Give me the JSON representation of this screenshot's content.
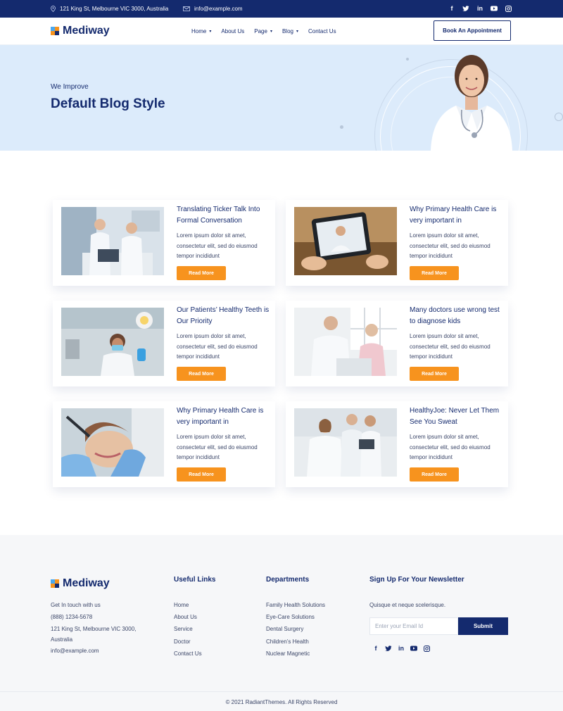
{
  "topbar": {
    "address": "121 King St, Melbourne VIC 3000, Australia",
    "email": "info@example.com",
    "social_icons": [
      "facebook-icon",
      "twitter-icon",
      "linkedin-icon",
      "youtube-icon",
      "instagram-icon"
    ]
  },
  "brand": {
    "name": "Mediway",
    "colors": {
      "navy": "#142a6e",
      "orange": "#f7931e",
      "hero_bg": "#dcebfb"
    }
  },
  "nav": {
    "items": [
      {
        "label": "Home",
        "dropdown": true
      },
      {
        "label": "About Us",
        "dropdown": false
      },
      {
        "label": "Page",
        "dropdown": true
      },
      {
        "label": "Blog",
        "dropdown": true
      },
      {
        "label": "Contact Us",
        "dropdown": false
      }
    ],
    "cta_label": "Book An Appointment"
  },
  "hero": {
    "kicker": "We Improve",
    "title": "Default Blog Style"
  },
  "posts": [
    {
      "title": "Translating Ticker Talk Into Formal Conversation",
      "excerpt": "Lorem ipsum dolor sit amet, consectetur elit, sed do eiusmod tempor incididunt",
      "button": "Read More"
    },
    {
      "title": "Why Primary Health Care is very important in",
      "excerpt": "Lorem ipsum dolor sit amet, consectetur elit, sed do eiusmod tempor incididunt",
      "button": "Read More"
    },
    {
      "title": "Our Patients’ Healthy Teeth is Our Priority",
      "excerpt": "Lorem ipsum dolor sit amet, consectetur elit, sed do eiusmod tempor incididunt",
      "button": "Read More"
    },
    {
      "title": "Many doctors use wrong test to diagnose kids",
      "excerpt": "Lorem ipsum dolor sit amet, consectetur elit, sed do eiusmod tempor incididunt",
      "button": "Read More"
    },
    {
      "title": "Why Primary Health Care is very important in",
      "excerpt": "Lorem ipsum dolor sit amet, consectetur elit, sed do eiusmod tempor incididunt",
      "button": "Read More"
    },
    {
      "title": "HealthyJoe: Never Let Them See You Sweat",
      "excerpt": "Lorem ipsum dolor sit amet, consectetur elit, sed do eiusmod tempor incididunt",
      "button": "Read More"
    }
  ],
  "footer": {
    "contact": {
      "intro": "Get In touch with us",
      "phone": "(888) 1234-5678",
      "address_line1": "121 King St, Melbourne VIC 3000,",
      "address_line2": "Australia",
      "email": "info@example.com"
    },
    "useful_links": {
      "title": "Useful Links",
      "items": [
        "Home",
        "About Us",
        "Service",
        "Doctor",
        "Contact Us"
      ]
    },
    "departments": {
      "title": "Departments",
      "items": [
        "Family Health Solutions",
        "Eye-Care Solutions",
        "Dental Surgery",
        "Children’s Health",
        "Nuclear Magnetic"
      ]
    },
    "newsletter": {
      "title": "Sign Up For Your Newsletter",
      "text": "Quisque et neque scelerisque.",
      "placeholder": "Enter your Email Id",
      "submit": "Submit"
    },
    "copyright": "© 2021 RadiantThemes. All Rights Reserved"
  }
}
